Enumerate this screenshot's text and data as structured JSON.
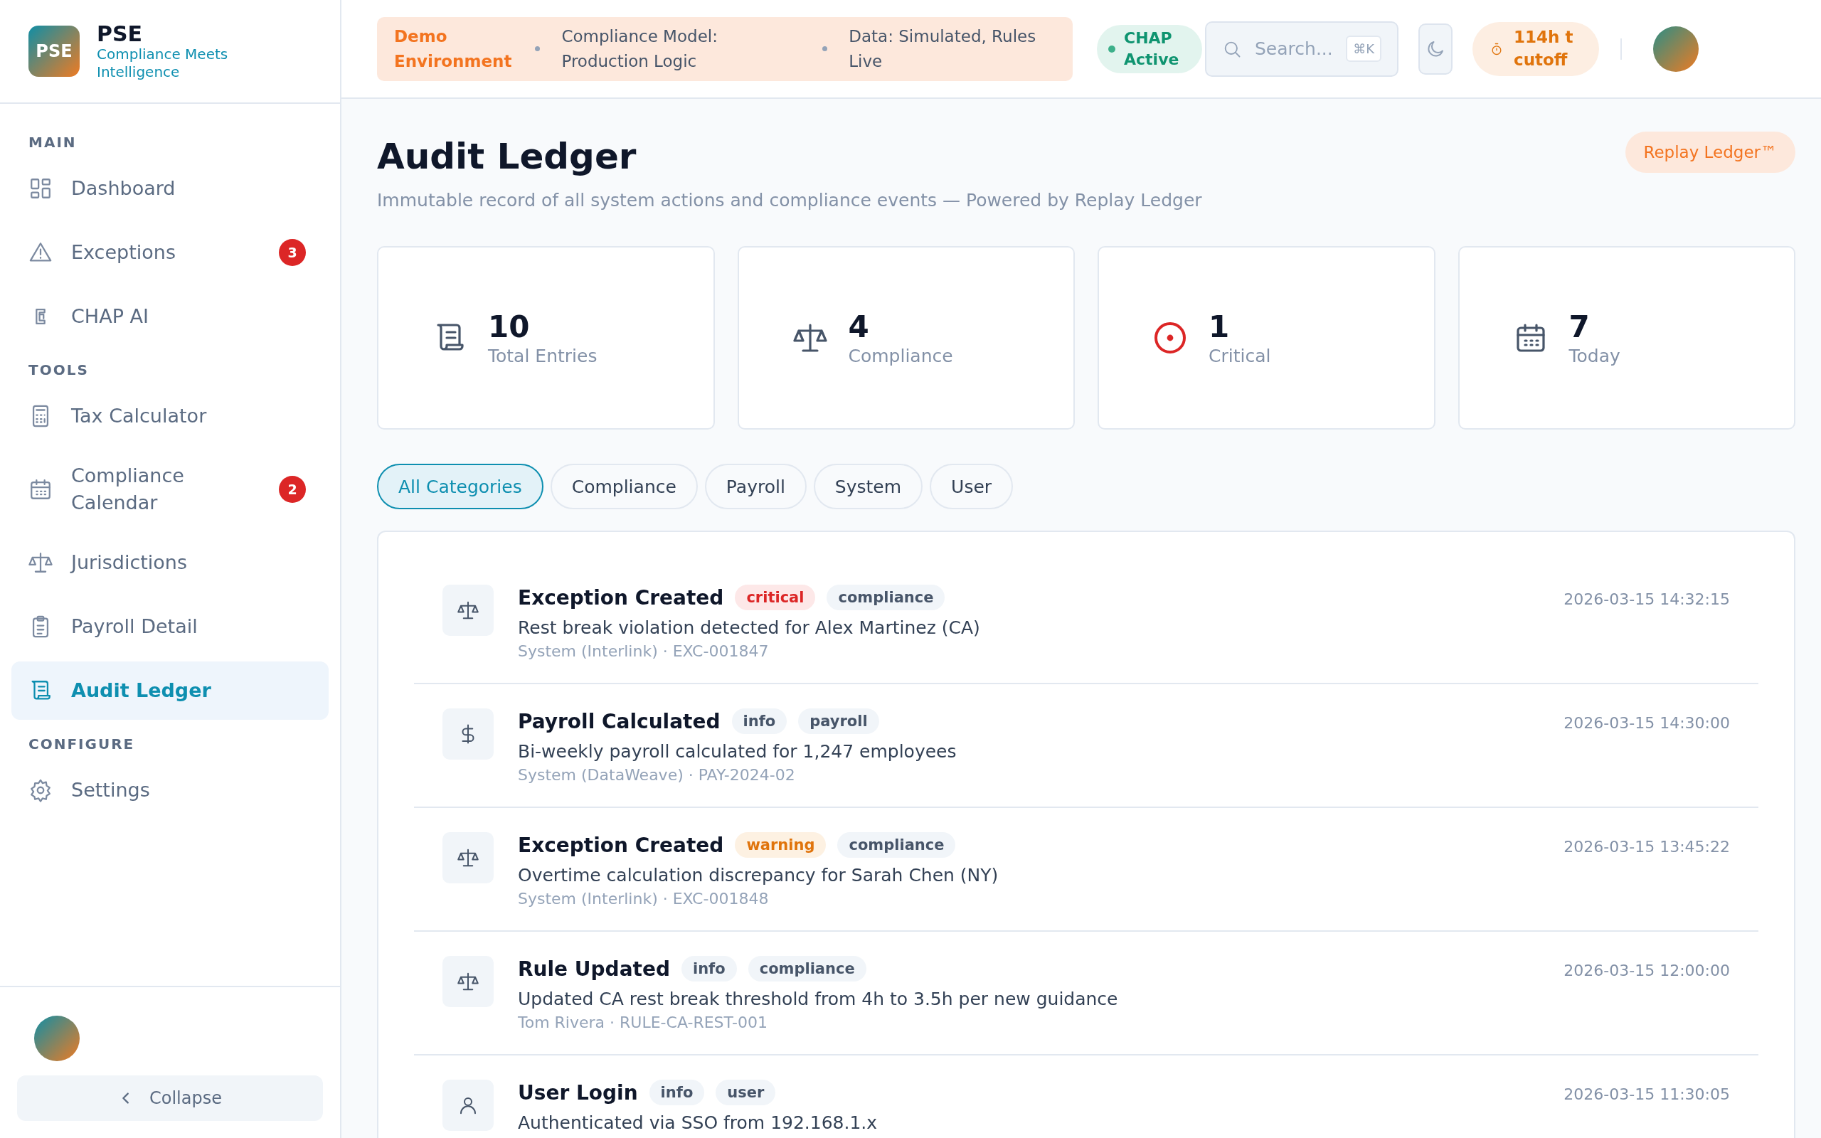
{
  "brand": {
    "logo": "PSE",
    "name": "PSE",
    "tagline": "Compliance Meets Intelligence"
  },
  "sidebar": {
    "sections": [
      {
        "title": "MAIN",
        "items": [
          {
            "label": "Dashboard",
            "kind": "grid",
            "selected": false
          },
          {
            "label": "Exceptions",
            "kind": "warning",
            "selected": false,
            "badge": "3"
          },
          {
            "label": "CHAP AI",
            "kind": "chip",
            "selected": false
          }
        ]
      },
      {
        "title": "TOOLS",
        "items": [
          {
            "label": "Tax Calculator",
            "kind": "calculator",
            "selected": false
          },
          {
            "label": "Compliance Calendar",
            "kind": "calendar",
            "selected": false,
            "badge": "2"
          },
          {
            "label": "Jurisdictions",
            "kind": "scale",
            "selected": false
          },
          {
            "label": "Payroll Detail",
            "kind": "clipboard",
            "selected": false
          },
          {
            "label": "Audit Ledger",
            "kind": "ledger",
            "selected": true
          }
        ]
      },
      {
        "title": "CONFIGURE",
        "items": [
          {
            "label": "Settings",
            "kind": "gear",
            "selected": false
          }
        ]
      }
    ],
    "collapse": "Collapse"
  },
  "topbar": {
    "environment": {
      "label": "Demo Environment",
      "model": "Compliance Model: Production Logic",
      "data": "Data: Simulated, Rules Live"
    },
    "chap_status": "CHAP Active",
    "search": {
      "placeholder": "Search...",
      "shortcut": "⌘K"
    },
    "cutoff": "114h t cutoff"
  },
  "page": {
    "title": "Audit Ledger",
    "subtitle": "Immutable record of all system actions and compliance events — Powered by Replay Ledger",
    "action": "Replay Ledger™"
  },
  "stats": [
    {
      "value": "10",
      "label": "Total Entries",
      "kind": "ledger"
    },
    {
      "value": "4",
      "label": "Compliance",
      "kind": "scale"
    },
    {
      "value": "1",
      "label": "Critical",
      "kind": "target"
    },
    {
      "value": "7",
      "label": "Today",
      "kind": "calendar"
    }
  ],
  "filters": [
    {
      "label": "All Categories",
      "selected": true
    },
    {
      "label": "Compliance",
      "selected": false
    },
    {
      "label": "Payroll",
      "selected": false
    },
    {
      "label": "System",
      "selected": false
    },
    {
      "label": "User",
      "selected": false
    }
  ],
  "entries": [
    {
      "kind": "scale",
      "title": "Exception Created",
      "severity": "critical",
      "category": "compliance",
      "description": "Rest break violation detected for Alex Martinez (CA)",
      "meta": "System (Interlink) · EXC-001847",
      "time": "2026-03-15 14:32:15"
    },
    {
      "kind": "dollar",
      "title": "Payroll Calculated",
      "severity": "info",
      "category": "payroll",
      "description": "Bi-weekly payroll calculated for 1,247 employees",
      "meta": "System (DataWeave) · PAY-2024-02",
      "time": "2026-03-15 14:30:00"
    },
    {
      "kind": "scale",
      "title": "Exception Created",
      "severity": "warning",
      "category": "compliance",
      "description": "Overtime calculation discrepancy for Sarah Chen (NY)",
      "meta": "System (Interlink) · EXC-001848",
      "time": "2026-03-15 13:45:22"
    },
    {
      "kind": "scale",
      "title": "Rule Updated",
      "severity": "info",
      "category": "compliance",
      "description": "Updated CA rest break threshold from 4h to 3.5h per new guidance",
      "meta": "Tom Rivera · RULE-CA-REST-001",
      "time": "2026-03-15 12:00:00"
    },
    {
      "kind": "person",
      "title": "User Login",
      "severity": "info",
      "category": "user",
      "description": "Authenticated via SSO from 192.168.1.x",
      "time": "2026-03-15 11:30:05"
    }
  ]
}
